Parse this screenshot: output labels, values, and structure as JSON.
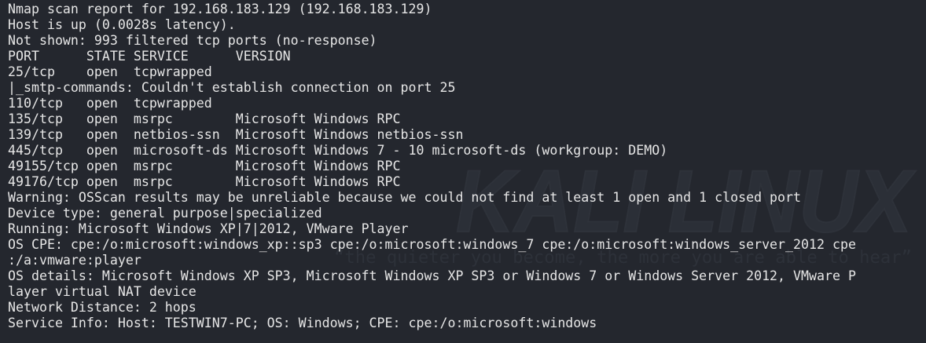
{
  "watermark": {
    "logo_text": "KALI LINUX",
    "tagline": "“the quieter you become, the more you are able to hear”"
  },
  "terminal": {
    "lines": [
      "Nmap scan report for 192.168.183.129 (192.168.183.129)",
      "Host is up (0.0028s latency).",
      "Not shown: 993 filtered tcp ports (no-response)",
      "PORT      STATE SERVICE      VERSION",
      "25/tcp    open  tcpwrapped",
      "|_smtp-commands: Couldn't establish connection on port 25",
      "110/tcp   open  tcpwrapped",
      "135/tcp   open  msrpc        Microsoft Windows RPC",
      "139/tcp   open  netbios-ssn  Microsoft Windows netbios-ssn",
      "445/tcp   open  microsoft-ds Microsoft Windows 7 - 10 microsoft-ds (workgroup: DEMO)",
      "49155/tcp open  msrpc        Microsoft Windows RPC",
      "49176/tcp open  msrpc        Microsoft Windows RPC",
      "Warning: OSScan results may be unreliable because we could not find at least 1 open and 1 closed port",
      "Device type: general purpose|specialized",
      "Running: Microsoft Windows XP|7|2012, VMware Player",
      "OS CPE: cpe:/o:microsoft:windows_xp::sp3 cpe:/o:microsoft:windows_7 cpe:/o:microsoft:windows_server_2012 cpe",
      ":/a:vmware:player",
      "OS details: Microsoft Windows XP SP3, Microsoft Windows XP SP3 or Windows 7 or Windows Server 2012, VMware P",
      "layer virtual NAT device",
      "Network Distance: 2 hops",
      "Service Info: Host: TESTWIN7-PC; OS: Windows; CPE: cpe:/o:microsoft:windows"
    ]
  }
}
